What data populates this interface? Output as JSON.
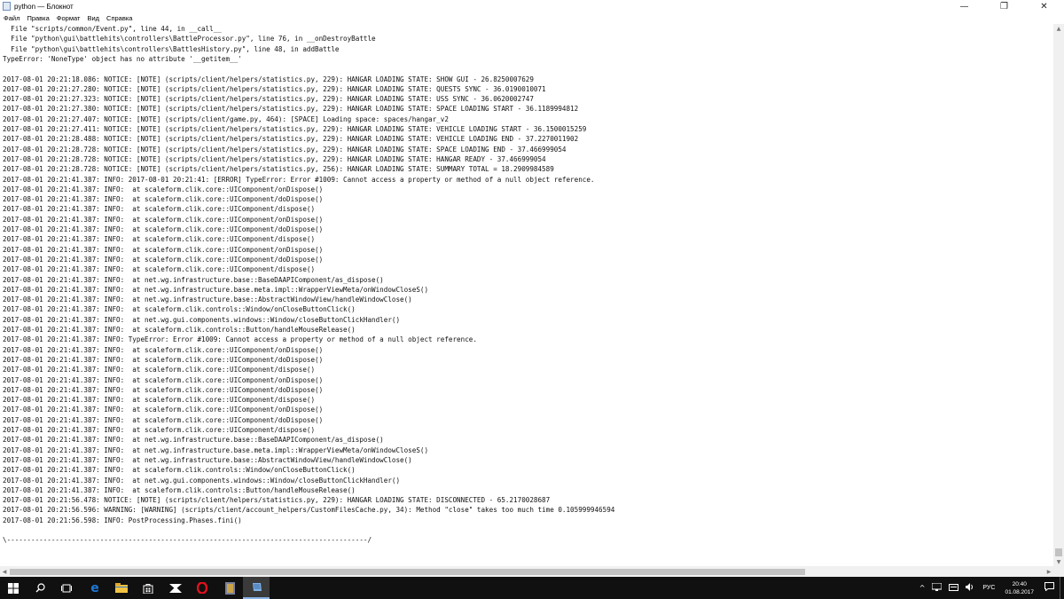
{
  "window": {
    "title": "python — Блокнот",
    "controls": {
      "minimize": "—",
      "maximize": "❐",
      "close": "✕"
    }
  },
  "menu": [
    "Файл",
    "Правка",
    "Формат",
    "Вид",
    "Справка"
  ],
  "lines": [
    "  File \"scripts/common/Event.py\", line 44, in __call__",
    "  File \"python\\gui\\battlehits\\controllers\\BattleProcessor.py\", line 76, in __onDestroyBattle",
    "  File \"python\\gui\\battlehits\\controllers\\BattlesHistory.py\", line 48, in addBattle",
    "TypeError: 'NoneType' object has no attribute '__getitem__'",
    "",
    "2017-08-01 20:21:18.086: NOTICE: [NOTE] (scripts/client/helpers/statistics.py, 229): HANGAR LOADING STATE: SHOW GUI - 26.8250007629",
    "2017-08-01 20:21:27.280: NOTICE: [NOTE] (scripts/client/helpers/statistics.py, 229): HANGAR LOADING STATE: QUESTS SYNC - 36.0190010071",
    "2017-08-01 20:21:27.323: NOTICE: [NOTE] (scripts/client/helpers/statistics.py, 229): HANGAR LOADING STATE: USS SYNC - 36.0620002747",
    "2017-08-01 20:21:27.380: NOTICE: [NOTE] (scripts/client/helpers/statistics.py, 229): HANGAR LOADING STATE: SPACE LOADING START - 36.1189994812",
    "2017-08-01 20:21:27.407: NOTICE: [NOTE] (scripts/client/game.py, 464): [SPACE] Loading space: spaces/hangar_v2",
    "2017-08-01 20:21:27.411: NOTICE: [NOTE] (scripts/client/helpers/statistics.py, 229): HANGAR LOADING STATE: VEHICLE LOADING START - 36.1500015259",
    "2017-08-01 20:21:28.488: NOTICE: [NOTE] (scripts/client/helpers/statistics.py, 229): HANGAR LOADING STATE: VEHICLE LOADING END - 37.2270011902",
    "2017-08-01 20:21:28.728: NOTICE: [NOTE] (scripts/client/helpers/statistics.py, 229): HANGAR LOADING STATE: SPACE LOADING END - 37.466999054",
    "2017-08-01 20:21:28.728: NOTICE: [NOTE] (scripts/client/helpers/statistics.py, 229): HANGAR LOADING STATE: HANGAR READY - 37.466999054",
    "2017-08-01 20:21:28.728: NOTICE: [NOTE] (scripts/client/helpers/statistics.py, 256): HANGAR LOADING STATE: SUMMARY TOTAL = 18.2909984589",
    "2017-08-01 20:21:41.387: INFO: 2017-08-01 20:21:41: [ERROR] TypeError: Error #1009: Cannot access a property or method of a null object reference.",
    "2017-08-01 20:21:41.387: INFO:  at scaleform.clik.core::UIComponent/onDispose()",
    "2017-08-01 20:21:41.387: INFO:  at scaleform.clik.core::UIComponent/doDispose()",
    "2017-08-01 20:21:41.387: INFO:  at scaleform.clik.core::UIComponent/dispose()",
    "2017-08-01 20:21:41.387: INFO:  at scaleform.clik.core::UIComponent/onDispose()",
    "2017-08-01 20:21:41.387: INFO:  at scaleform.clik.core::UIComponent/doDispose()",
    "2017-08-01 20:21:41.387: INFO:  at scaleform.clik.core::UIComponent/dispose()",
    "2017-08-01 20:21:41.387: INFO:  at scaleform.clik.core::UIComponent/onDispose()",
    "2017-08-01 20:21:41.387: INFO:  at scaleform.clik.core::UIComponent/doDispose()",
    "2017-08-01 20:21:41.387: INFO:  at scaleform.clik.core::UIComponent/dispose()",
    "2017-08-01 20:21:41.387: INFO:  at net.wg.infrastructure.base::BaseDAAPIComponent/as_dispose()",
    "2017-08-01 20:21:41.387: INFO:  at net.wg.infrastructure.base.meta.impl::WrapperViewMeta/onWindowCloseS()",
    "2017-08-01 20:21:41.387: INFO:  at net.wg.infrastructure.base::AbstractWindowView/handleWindowClose()",
    "2017-08-01 20:21:41.387: INFO:  at scaleform.clik.controls::Window/onCloseButtonClick()",
    "2017-08-01 20:21:41.387: INFO:  at net.wg.gui.components.windows::Window/closeButtonClickHandler()",
    "2017-08-01 20:21:41.387: INFO:  at scaleform.clik.controls::Button/handleMouseRelease()",
    "2017-08-01 20:21:41.387: INFO: TypeError: Error #1009: Cannot access a property or method of a null object reference.",
    "2017-08-01 20:21:41.387: INFO:  at scaleform.clik.core::UIComponent/onDispose()",
    "2017-08-01 20:21:41.387: INFO:  at scaleform.clik.core::UIComponent/doDispose()",
    "2017-08-01 20:21:41.387: INFO:  at scaleform.clik.core::UIComponent/dispose()",
    "2017-08-01 20:21:41.387: INFO:  at scaleform.clik.core::UIComponent/onDispose()",
    "2017-08-01 20:21:41.387: INFO:  at scaleform.clik.core::UIComponent/doDispose()",
    "2017-08-01 20:21:41.387: INFO:  at scaleform.clik.core::UIComponent/dispose()",
    "2017-08-01 20:21:41.387: INFO:  at scaleform.clik.core::UIComponent/onDispose()",
    "2017-08-01 20:21:41.387: INFO:  at scaleform.clik.core::UIComponent/doDispose()",
    "2017-08-01 20:21:41.387: INFO:  at scaleform.clik.core::UIComponent/dispose()",
    "2017-08-01 20:21:41.387: INFO:  at net.wg.infrastructure.base::BaseDAAPIComponent/as_dispose()",
    "2017-08-01 20:21:41.387: INFO:  at net.wg.infrastructure.base.meta.impl::WrapperViewMeta/onWindowCloseS()",
    "2017-08-01 20:21:41.387: INFO:  at net.wg.infrastructure.base::AbstractWindowView/handleWindowClose()",
    "2017-08-01 20:21:41.387: INFO:  at scaleform.clik.controls::Window/onCloseButtonClick()",
    "2017-08-01 20:21:41.387: INFO:  at net.wg.gui.components.windows::Window/closeButtonClickHandler()",
    "2017-08-01 20:21:41.387: INFO:  at scaleform.clik.controls::Button/handleMouseRelease()",
    "2017-08-01 20:21:56.478: NOTICE: [NOTE] (scripts/client/helpers/statistics.py, 229): HANGAR LOADING STATE: DISCONNECTED - 65.2170028687",
    "2017-08-01 20:21:56.596: WARNING: [WARNING] (scripts/client/account_helpers/CustomFilesCache.py, 34): Method \"close\" takes too much time 0.105999946594",
    "2017-08-01 20:21:56.598: INFO: PostProcessing.Phases.fini()",
    "",
    "\\-----------------------------------------------------------------------------------------/"
  ],
  "taskbar": {
    "apps": [
      {
        "name": "start-button",
        "glyph": "⊞"
      },
      {
        "name": "search-button",
        "glyph": "⌕"
      },
      {
        "name": "task-view-button",
        "glyph": "▭"
      },
      {
        "name": "edge-app",
        "glyph": "e"
      },
      {
        "name": "file-explorer-app",
        "glyph": "▬"
      },
      {
        "name": "store-app",
        "glyph": "▣"
      },
      {
        "name": "mail-app",
        "glyph": "✉"
      },
      {
        "name": "opera-app",
        "glyph": "O"
      },
      {
        "name": "game-app",
        "glyph": "▮"
      },
      {
        "name": "notepad-app",
        "glyph": "▰"
      }
    ],
    "tray": {
      "chevron": "^",
      "language": "РУС",
      "time": "20:40",
      "date": "01.08.2017"
    }
  },
  "colors": {
    "taskbar": "#101010",
    "opera": "#e0101e",
    "edge": "#1e7ad8",
    "explorer": "#f3c443",
    "notepad_active": "#8ab4e6"
  }
}
